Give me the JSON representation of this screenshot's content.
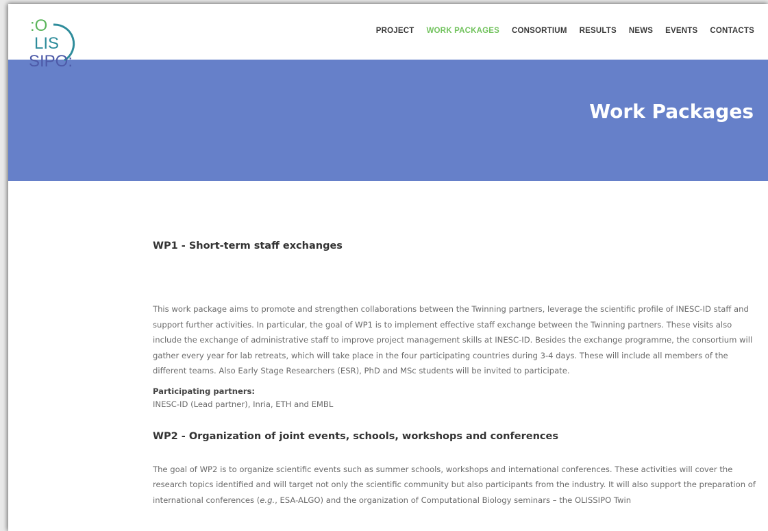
{
  "logo": {
    "line1": ":O",
    "line2": "LIS",
    "line3": "SIPO:"
  },
  "nav": {
    "items": [
      {
        "label": "PROJECT"
      },
      {
        "label": "WORK PACKAGES"
      },
      {
        "label": "CONSORTIUM"
      },
      {
        "label": "RESULTS"
      },
      {
        "label": "NEWS"
      },
      {
        "label": "EVENTS"
      },
      {
        "label": "CONTACTS"
      }
    ],
    "active_color": "#73c35f"
  },
  "hero": {
    "title": "Work Packages",
    "color": "#6680c9"
  },
  "wp1": {
    "title": "WP1 - Short-term staff exchanges",
    "text": "This work package aims to promote and strengthen collaborations between the Twinning partners, leverage the scientific profile of INESC-ID staff and support further activities. In particular, the goal of WP1 is to implement effective staff exchange between the Twinning partners. These visits also include the exchange of administrative staff to improve project management skills at INESC-ID. Besides the exchange programme, the consortium will gather every year for lab retreats, which will take place in the four participating countries during 3-4 days. These will include all members of the different teams. Also Early Stage Researchers (ESR), PhD and MSc students will be invited to participate.",
    "partners_label": "Participating partners:",
    "partners": "INESC-ID (Lead partner), Inria, ETH and EMBL"
  },
  "wp2": {
    "title": "WP2 - Organization of joint events, schools, workshops and conferences",
    "text_a": "The goal of WP2 is to organize scientific events such as summer schools, workshops and international conferences. These activities will cover the research topics identified and will target not only the scientific community but also participants from the industry. It will also support the preparation of international conferences (",
    "text_eg": "e.g.",
    "text_b": ", ESA-ALGO) and the organization of Computational Biology seminars – the OLISSIPO Twin"
  }
}
